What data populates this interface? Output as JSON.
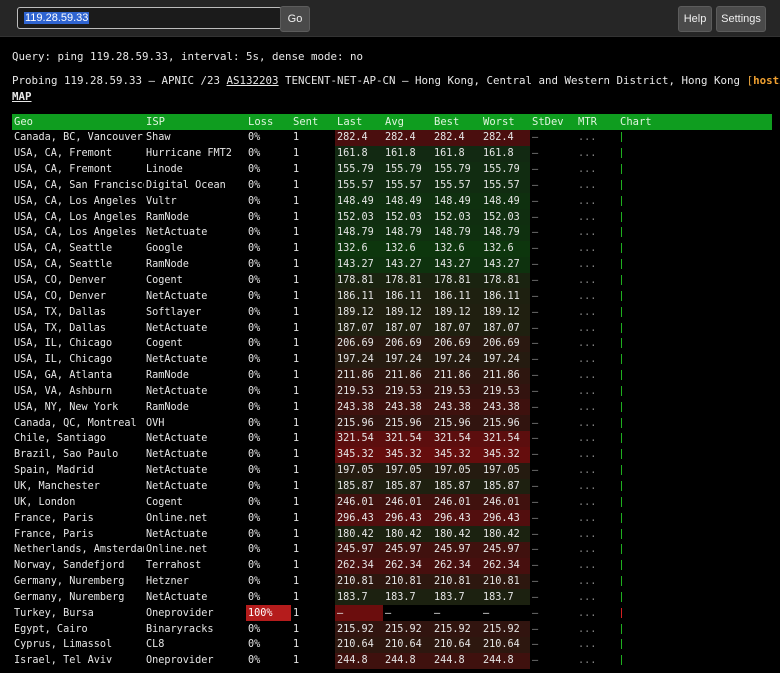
{
  "toolbar": {
    "input_value": "119.28.59.33",
    "go_label": "Go",
    "help_label": "Help",
    "settings_label": "Settings"
  },
  "query_line": "Query: ping 119.28.59.33, interval: 5s, dense mode: no",
  "probe": {
    "prefix": "Probing 119.28.59.33 — APNIC /23 ",
    "asn": "AS132203",
    "location": " TENCENT-NET-AP-CN — Hong Kong, Central and Western District, Hong Kong ",
    "tag_open": "[",
    "tag": "hosting",
    "tag_close": "]",
    "map_link": "MAP"
  },
  "table": {
    "headers": [
      "Geo",
      "ISP",
      "Loss",
      "Sent",
      "Last",
      "Avg",
      "Best",
      "Worst",
      "StDev",
      "MTR",
      "Chart"
    ],
    "rows": [
      {
        "geo": "Canada, BC, Vancouver",
        "isp": "Shaw",
        "loss": "0%",
        "sent": "1",
        "last": "282.4",
        "avg": "282.4",
        "best": "282.4",
        "worst": "282.4",
        "stdev": "–",
        "mtr": "...",
        "color": "#4a0e0e",
        "chart": "#1fb01f"
      },
      {
        "geo": "USA, CA, Fremont",
        "isp": "Hurricane FMT2",
        "loss": "0%",
        "sent": "1",
        "last": "161.8",
        "avg": "161.8",
        "best": "161.8",
        "worst": "161.8",
        "stdev": "–",
        "mtr": "...",
        "color": "#122912",
        "chart": "#1fb01f"
      },
      {
        "geo": "USA, CA, Fremont",
        "isp": "Linode",
        "loss": "0%",
        "sent": "1",
        "last": "155.79",
        "avg": "155.79",
        "best": "155.79",
        "worst": "155.79",
        "stdev": "–",
        "mtr": "...",
        "color": "#112c11",
        "chart": "#1fb01f"
      },
      {
        "geo": "USA, CA, San Francisco",
        "isp": "Digital Ocean",
        "loss": "0%",
        "sent": "1",
        "last": "155.57",
        "avg": "155.57",
        "best": "155.57",
        "worst": "155.57",
        "stdev": "–",
        "mtr": "...",
        "color": "#112c11",
        "chart": "#1fb01f"
      },
      {
        "geo": "USA, CA, Los Angeles",
        "isp": "Vultr",
        "loss": "0%",
        "sent": "1",
        "last": "148.49",
        "avg": "148.49",
        "best": "148.49",
        "worst": "148.49",
        "stdev": "–",
        "mtr": "...",
        "color": "#0f300f",
        "chart": "#1fb01f"
      },
      {
        "geo": "USA, CA, Los Angeles",
        "isp": "RamNode",
        "loss": "0%",
        "sent": "1",
        "last": "152.03",
        "avg": "152.03",
        "best": "152.03",
        "worst": "152.03",
        "stdev": "–",
        "mtr": "...",
        "color": "#102e10",
        "chart": "#1fb01f"
      },
      {
        "geo": "USA, CA, Los Angeles",
        "isp": "NetActuate",
        "loss": "0%",
        "sent": "1",
        "last": "148.79",
        "avg": "148.79",
        "best": "148.79",
        "worst": "148.79",
        "stdev": "–",
        "mtr": "...",
        "color": "#0f300f",
        "chart": "#1fb01f"
      },
      {
        "geo": "USA, CA, Seattle",
        "isp": "Google",
        "loss": "0%",
        "sent": "1",
        "last": "132.6",
        "avg": "132.6",
        "best": "132.6",
        "worst": "132.6",
        "stdev": "–",
        "mtr": "...",
        "color": "#0d360d",
        "chart": "#1fb01f"
      },
      {
        "geo": "USA, CA, Seattle",
        "isp": "RamNode",
        "loss": "0%",
        "sent": "1",
        "last": "143.27",
        "avg": "143.27",
        "best": "143.27",
        "worst": "143.27",
        "stdev": "–",
        "mtr": "...",
        "color": "#0e320e",
        "chart": "#1fb01f"
      },
      {
        "geo": "USA, CO, Denver",
        "isp": "Cogent",
        "loss": "0%",
        "sent": "1",
        "last": "178.81",
        "avg": "178.81",
        "best": "178.81",
        "worst": "178.81",
        "stdev": "–",
        "mtr": "...",
        "color": "#1a2310",
        "chart": "#1fb01f"
      },
      {
        "geo": "USA, CO, Denver",
        "isp": "NetActuate",
        "loss": "0%",
        "sent": "1",
        "last": "186.11",
        "avg": "186.11",
        "best": "186.11",
        "worst": "186.11",
        "stdev": "–",
        "mtr": "...",
        "color": "#1e2010",
        "chart": "#1fb01f"
      },
      {
        "geo": "USA, TX, Dallas",
        "isp": "Softlayer",
        "loss": "0%",
        "sent": "1",
        "last": "189.12",
        "avg": "189.12",
        "best": "189.12",
        "worst": "189.12",
        "stdev": "–",
        "mtr": "...",
        "color": "#201f10",
        "chart": "#1fb01f"
      },
      {
        "geo": "USA, TX, Dallas",
        "isp": "NetActuate",
        "loss": "0%",
        "sent": "1",
        "last": "187.07",
        "avg": "187.07",
        "best": "187.07",
        "worst": "187.07",
        "stdev": "–",
        "mtr": "...",
        "color": "#1f2010",
        "chart": "#1fb01f"
      },
      {
        "geo": "USA, IL, Chicago",
        "isp": "Cogent",
        "loss": "0%",
        "sent": "1",
        "last": "206.69",
        "avg": "206.69",
        "best": "206.69",
        "worst": "206.69",
        "stdev": "–",
        "mtr": "...",
        "color": "#2a1810",
        "chart": "#1fb01f"
      },
      {
        "geo": "USA, IL, Chicago",
        "isp": "NetActuate",
        "loss": "0%",
        "sent": "1",
        "last": "197.24",
        "avg": "197.24",
        "best": "197.24",
        "worst": "197.24",
        "stdev": "–",
        "mtr": "...",
        "color": "#251b10",
        "chart": "#1fb01f"
      },
      {
        "geo": "USA, GA, Atlanta",
        "isp": "RamNode",
        "loss": "0%",
        "sent": "1",
        "last": "211.86",
        "avg": "211.86",
        "best": "211.86",
        "worst": "211.86",
        "stdev": "–",
        "mtr": "...",
        "color": "#2e160f",
        "chart": "#1fb01f"
      },
      {
        "geo": "USA, VA, Ashburn",
        "isp": "NetActuate",
        "loss": "0%",
        "sent": "1",
        "last": "219.53",
        "avg": "219.53",
        "best": "219.53",
        "worst": "219.53",
        "stdev": "–",
        "mtr": "...",
        "color": "#33130f",
        "chart": "#1fb01f"
      },
      {
        "geo": "USA, NY, New York",
        "isp": "RamNode",
        "loss": "0%",
        "sent": "1",
        "last": "243.38",
        "avg": "243.38",
        "best": "243.38",
        "worst": "243.38",
        "stdev": "–",
        "mtr": "...",
        "color": "#3e110e",
        "chart": "#1fb01f"
      },
      {
        "geo": "Canada, QC, Montreal",
        "isp": "OVH",
        "loss": "0%",
        "sent": "1",
        "last": "215.96",
        "avg": "215.96",
        "best": "215.96",
        "worst": "215.96",
        "stdev": "–",
        "mtr": "...",
        "color": "#31140f",
        "chart": "#1fb01f"
      },
      {
        "geo": "Chile, Santiago",
        "isp": "NetActuate",
        "loss": "0%",
        "sent": "1",
        "last": "321.54",
        "avg": "321.54",
        "best": "321.54",
        "worst": "321.54",
        "stdev": "–",
        "mtr": "...",
        "color": "#5c0e0e",
        "chart": "#1fb01f"
      },
      {
        "geo": "Brazil, Sao Paulo",
        "isp": "NetActuate",
        "loss": "0%",
        "sent": "1",
        "last": "345.32",
        "avg": "345.32",
        "best": "345.32",
        "worst": "345.32",
        "stdev": "–",
        "mtr": "...",
        "color": "#650d0d",
        "chart": "#1fb01f"
      },
      {
        "geo": "Spain, Madrid",
        "isp": "NetActuate",
        "loss": "0%",
        "sent": "1",
        "last": "197.05",
        "avg": "197.05",
        "best": "197.05",
        "worst": "197.05",
        "stdev": "–",
        "mtr": "...",
        "color": "#251b10",
        "chart": "#1fb01f"
      },
      {
        "geo": "UK, Manchester",
        "isp": "NetActuate",
        "loss": "0%",
        "sent": "1",
        "last": "185.87",
        "avg": "185.87",
        "best": "185.87",
        "worst": "185.87",
        "stdev": "–",
        "mtr": "...",
        "color": "#1e2010",
        "chart": "#1fb01f"
      },
      {
        "geo": "UK, London",
        "isp": "Cogent",
        "loss": "0%",
        "sent": "1",
        "last": "246.01",
        "avg": "246.01",
        "best": "246.01",
        "worst": "246.01",
        "stdev": "–",
        "mtr": "...",
        "color": "#40110e",
        "chart": "#1fb01f"
      },
      {
        "geo": "France, Paris",
        "isp": "Online.net",
        "loss": "0%",
        "sent": "1",
        "last": "296.43",
        "avg": "296.43",
        "best": "296.43",
        "worst": "296.43",
        "stdev": "–",
        "mtr": "...",
        "color": "#520e0e",
        "chart": "#1fb01f"
      },
      {
        "geo": "France, Paris",
        "isp": "NetActuate",
        "loss": "0%",
        "sent": "1",
        "last": "180.42",
        "avg": "180.42",
        "best": "180.42",
        "worst": "180.42",
        "stdev": "–",
        "mtr": "...",
        "color": "#1b2210",
        "chart": "#1fb01f"
      },
      {
        "geo": "Netherlands, Amsterdam",
        "isp": "Online.net",
        "loss": "0%",
        "sent": "1",
        "last": "245.97",
        "avg": "245.97",
        "best": "245.97",
        "worst": "245.97",
        "stdev": "–",
        "mtr": "...",
        "color": "#40110e",
        "chart": "#1fb01f"
      },
      {
        "geo": "Norway, Sandefjord",
        "isp": "Terrahost",
        "loss": "0%",
        "sent": "1",
        "last": "262.34",
        "avg": "262.34",
        "best": "262.34",
        "worst": "262.34",
        "stdev": "–",
        "mtr": "...",
        "color": "#470f0e",
        "chart": "#1fb01f"
      },
      {
        "geo": "Germany, Nuremberg",
        "isp": "Hetzner",
        "loss": "0%",
        "sent": "1",
        "last": "210.81",
        "avg": "210.81",
        "best": "210.81",
        "worst": "210.81",
        "stdev": "–",
        "mtr": "...",
        "color": "#2d170f",
        "chart": "#1fb01f"
      },
      {
        "geo": "Germany, Nuremberg",
        "isp": "NetActuate",
        "loss": "0%",
        "sent": "1",
        "last": "183.7",
        "avg": "183.7",
        "best": "183.7",
        "worst": "183.7",
        "stdev": "–",
        "mtr": "...",
        "color": "#1c2110",
        "chart": "#1fb01f"
      },
      {
        "geo": "Turkey, Bursa",
        "isp": "Oneprovider",
        "loss": "100%",
        "sent": "1",
        "last": "–",
        "avg": "–",
        "best": "–",
        "worst": "–",
        "stdev": "–",
        "mtr": "...",
        "color": "#000000",
        "chart": "#d42020",
        "dead": true
      },
      {
        "geo": "Egypt, Cairo",
        "isp": "Binaryracks",
        "loss": "0%",
        "sent": "1",
        "last": "215.92",
        "avg": "215.92",
        "best": "215.92",
        "worst": "215.92",
        "stdev": "–",
        "mtr": "...",
        "color": "#31140f",
        "chart": "#1fb01f"
      },
      {
        "geo": "Cyprus, Limassol",
        "isp": "CL8",
        "loss": "0%",
        "sent": "1",
        "last": "210.64",
        "avg": "210.64",
        "best": "210.64",
        "worst": "210.64",
        "stdev": "–",
        "mtr": "...",
        "color": "#2d170f",
        "chart": "#1fb01f"
      },
      {
        "geo": "Israel, Tel Aviv",
        "isp": "Oneprovider",
        "loss": "0%",
        "sent": "1",
        "last": "244.8",
        "avg": "244.8",
        "best": "244.8",
        "worst": "244.8",
        "stdev": "–",
        "mtr": "...",
        "color": "#3f110e",
        "chart": "#1fb01f"
      }
    ]
  }
}
